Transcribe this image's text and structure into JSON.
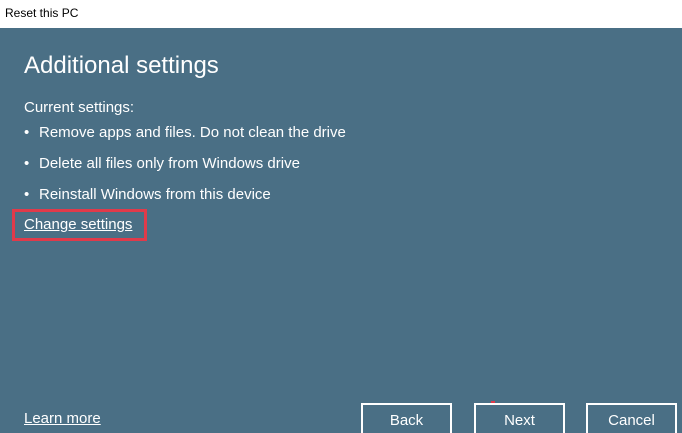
{
  "window": {
    "title": "Reset this PC"
  },
  "main": {
    "heading": "Additional settings",
    "current_settings_label": "Current settings:",
    "bullet_char": "•",
    "settings": [
      "Remove apps and files. Do not clean the drive",
      "Delete all files only from Windows drive",
      "Reinstall Windows from this device"
    ],
    "change_settings_link": "Change settings"
  },
  "footer": {
    "learn_more": "Learn more",
    "back_label": "Back",
    "next_label": "Next",
    "cancel_label": "Cancel"
  },
  "colors": {
    "background": "#4a6f85",
    "highlight": "#e03a4a",
    "text": "#ffffff"
  }
}
